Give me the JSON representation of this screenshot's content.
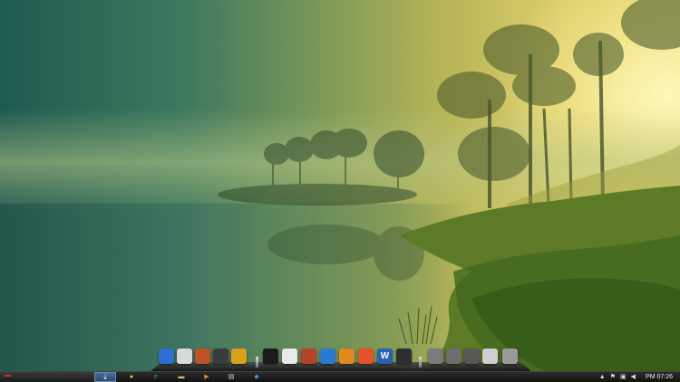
{
  "desktop": {
    "wallpaper": "misty-lake-sunrise"
  },
  "dock": {
    "items": [
      {
        "icon": "computer-icon",
        "color": "#2f6fd0",
        "glyph": ""
      },
      {
        "icon": "settings-panel-icon",
        "color": "#d9d9d9",
        "glyph": ""
      },
      {
        "icon": "speaker-icon",
        "color": "#c0522a",
        "glyph": ""
      },
      {
        "icon": "media-player-icon",
        "color": "#3b3b3b",
        "glyph": ""
      },
      {
        "icon": "gold-app-icon",
        "color": "#d7a11a",
        "glyph": ""
      },
      {
        "icon": "black-app-icon",
        "color": "#1c1c1c",
        "glyph": ""
      },
      {
        "icon": "chrome-icon",
        "color": "#e9e9e9",
        "glyph": ""
      },
      {
        "icon": "sliders-icon",
        "color": "#b4452a",
        "glyph": ""
      },
      {
        "icon": "app-blue-icon",
        "color": "#2a79d4",
        "glyph": ""
      },
      {
        "icon": "package-icon",
        "color": "#e08a1e",
        "glyph": ""
      },
      {
        "icon": "photo-icon",
        "color": "#e5512a",
        "glyph": ""
      },
      {
        "icon": "word-icon",
        "color": "#2b5fb3",
        "glyph": "W"
      },
      {
        "icon": "terminal-icon",
        "color": "#2e2e2e",
        "glyph": ""
      },
      {
        "icon": "network-icon",
        "color": "#7a7a7a",
        "glyph": ""
      },
      {
        "icon": "drive-icon",
        "color": "#6e6e6e",
        "glyph": ""
      },
      {
        "icon": "cd-drive-icon",
        "color": "#585858",
        "glyph": ""
      },
      {
        "icon": "film-icon",
        "color": "#cfcfcf",
        "glyph": ""
      },
      {
        "icon": "disk-icon",
        "color": "#9a9a9a",
        "glyph": ""
      }
    ]
  },
  "taskbar": {
    "active_task_glyph": "⇣",
    "pinned": [
      {
        "icon": "chrome-icon",
        "glyph": "●",
        "color": "#e5c430"
      },
      {
        "icon": "internet-explorer-icon",
        "glyph": "e",
        "color": "#3b8bd8"
      },
      {
        "icon": "folder-icon",
        "glyph": "▬",
        "color": "#e8c35a"
      },
      {
        "icon": "media-player-icon",
        "glyph": "▶",
        "color": "#e58a1f"
      },
      {
        "icon": "notepad-icon",
        "glyph": "▤",
        "color": "#dcdcdc"
      },
      {
        "icon": "network-icon",
        "glyph": "◆",
        "color": "#4c8cd9"
      }
    ],
    "tray": {
      "icons": [
        "show-hidden-icon",
        "flag-icon",
        "network-tray-icon",
        "volume-icon"
      ],
      "glyphs": [
        "▲",
        "⚑",
        "▣",
        "◀"
      ],
      "clock": "PM 07:26"
    }
  }
}
